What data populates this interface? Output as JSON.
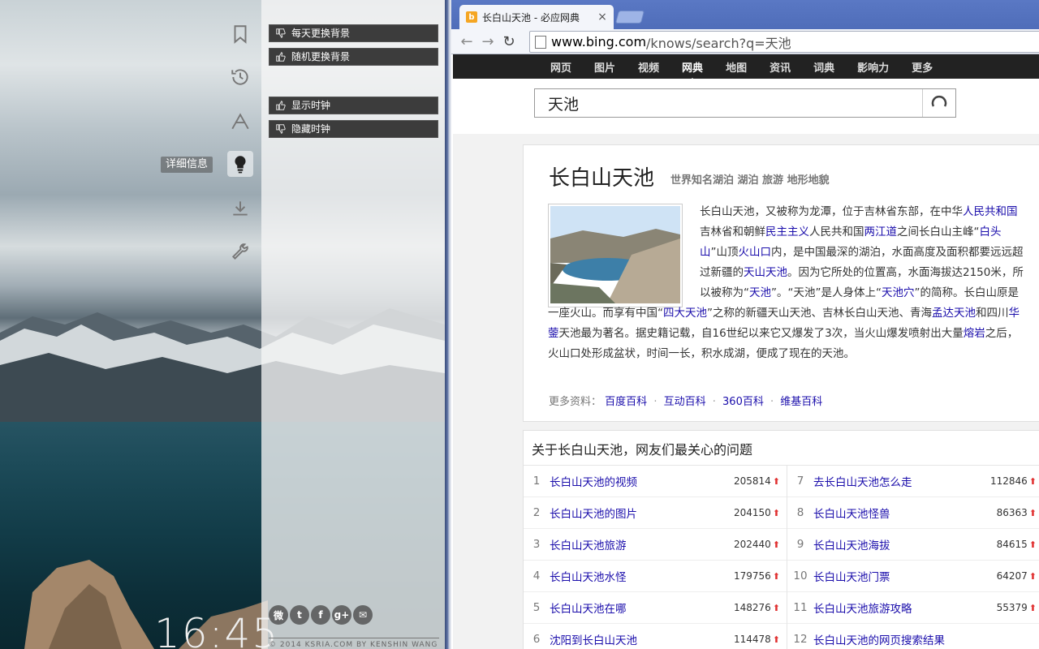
{
  "left_panel": {
    "tooltip": "详细信息",
    "buttons": [
      {
        "label": "每天更换背景",
        "icon": "thumbs-down-icon"
      },
      {
        "label": "随机更换背景",
        "icon": "thumbs-up-icon"
      },
      {
        "label": "显示时钟",
        "icon": "thumbs-up-icon"
      },
      {
        "label": "隐藏时钟",
        "icon": "thumbs-down-icon"
      }
    ],
    "side_icons": [
      "bookmark-icon",
      "history-icon",
      "apps-icon",
      "lightbulb-icon",
      "download-icon",
      "wrench-icon"
    ],
    "social": [
      "weibo-icon",
      "twitter-icon",
      "facebook-icon",
      "google-plus-icon",
      "mail-icon"
    ],
    "social_glyphs": {
      "weibo": "微",
      "twitter": "t",
      "facebook": "f",
      "gplus": "g+",
      "mail": "✉"
    },
    "copyright": "© 2014 KSRIA.COM BY KENSHIN WANG",
    "clock": "16:45"
  },
  "browser": {
    "tab_title": "长白山天池 - 必应网典",
    "tab_close": "×",
    "favicon": "b",
    "url_host": "www.bing.com",
    "url_path": "/knows/search?q=天池",
    "nav_back": "←",
    "nav_forward": "→",
    "nav_reload": "↻"
  },
  "bing": {
    "nav": [
      "网页",
      "图片",
      "视频",
      "网典",
      "地图",
      "资讯",
      "词典",
      "影响力",
      "更多"
    ],
    "active_nav": "网典",
    "search_query": "天池"
  },
  "knowledge": {
    "title": "长白山天池",
    "subtitle": "世界知名湖泊 湖泊 旅游 地形地貌",
    "text_segments": [
      {
        "t": "长白山天池，又被称为龙潭，位于吉林省东部，在中华"
      },
      {
        "t": "人民共和国",
        "link": true
      },
      {
        "t": "吉林省和朝鲜"
      },
      {
        "t": "民主主义",
        "link": true
      },
      {
        "t": "人民共和国"
      },
      {
        "t": "两江道",
        "link": true
      },
      {
        "t": "之间长白山主峰“"
      },
      {
        "t": "白头山",
        "link": true
      },
      {
        "t": "”山顶"
      },
      {
        "t": "火山口",
        "link": true
      },
      {
        "t": "内，是中国最深的湖泊，水面高度及面积都要远远超过新疆的"
      },
      {
        "t": "天山天池",
        "link": true
      },
      {
        "t": "。因为它所处的位置高，水面海拔达2150米，所以被称为“"
      },
      {
        "t": "天池",
        "link": true
      },
      {
        "t": "”。“天池”是人身体上“"
      },
      {
        "t": "天池穴",
        "link": true
      },
      {
        "t": "”的简称。长白山原是一座火山。而享有中国“"
      },
      {
        "t": "四大天池",
        "link": true
      },
      {
        "t": "”之称的新疆天山天池、吉林长白山天池、青海"
      },
      {
        "t": "孟达天池",
        "link": true
      },
      {
        "t": "和四川"
      },
      {
        "t": "华蓥",
        "link": true
      },
      {
        "t": "天池最为著名。据史籍记载，自16世纪以来它又爆发了3次，当火山爆发喷射出大量"
      },
      {
        "t": "熔岩",
        "link": true
      },
      {
        "t": "之后，火山口处形成盆状，时间一长，积水成湖，便成了现在的天池。"
      }
    ],
    "more_label": "更多资料：",
    "more_links": [
      "百度百科",
      "互动百科",
      "360百科",
      "维基百科"
    ],
    "more_sep": "·"
  },
  "questions": {
    "title": "关于长白山天池，网友们最关心的问题",
    "left": [
      {
        "n": "1",
        "q": "长白山天池的视频",
        "c": "205814"
      },
      {
        "n": "2",
        "q": "长白山天池的图片",
        "c": "204150"
      },
      {
        "n": "3",
        "q": "长白山天池旅游",
        "c": "202440"
      },
      {
        "n": "4",
        "q": "长白山天池水怪",
        "c": "179756"
      },
      {
        "n": "5",
        "q": "长白山天池在哪",
        "c": "148276"
      },
      {
        "n": "6",
        "q": "沈阳到长白山天池",
        "c": "114478"
      }
    ],
    "right": [
      {
        "n": "7",
        "q": "去长白山天池怎么走",
        "c": "112846"
      },
      {
        "n": "8",
        "q": "长白山天池怪兽",
        "c": "86363"
      },
      {
        "n": "9",
        "q": "长白山天池海拔",
        "c": "84615"
      },
      {
        "n": "10",
        "q": "长白山天池门票",
        "c": "64207"
      },
      {
        "n": "11",
        "q": "长白山天池旅游攻略",
        "c": "55379"
      },
      {
        "n": "12",
        "q": "长白山天池的网页搜索结果",
        "c": ""
      }
    ],
    "arrow": "⬆"
  }
}
